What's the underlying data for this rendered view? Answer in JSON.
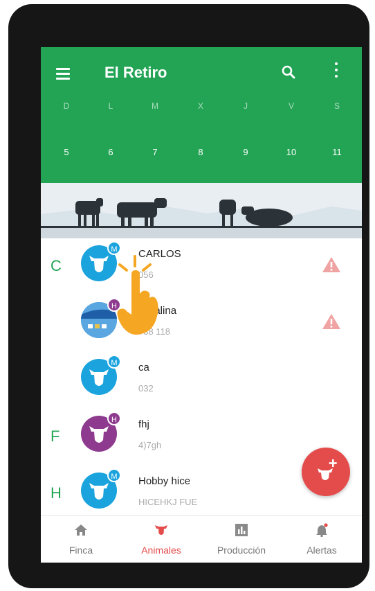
{
  "header": {
    "title": "El Retiro",
    "days": [
      "D",
      "L",
      "M",
      "X",
      "J",
      "V",
      "S"
    ],
    "dates": [
      "5",
      "6",
      "7",
      "8",
      "9",
      "10",
      "11"
    ]
  },
  "animals": [
    {
      "letter": "C",
      "badge": "M",
      "name": "CARLOS",
      "code": "056",
      "alert": true,
      "avatar": "cow-blue"
    },
    {
      "letter": "",
      "badge": "H",
      "name": "Catalina",
      "code": "738 118",
      "alert": true,
      "avatar": "photo"
    },
    {
      "letter": "",
      "badge": "M",
      "name": "ca",
      "code": "032",
      "alert": false,
      "avatar": "cow-blue"
    },
    {
      "letter": "F",
      "badge": "H",
      "name": "fhj",
      "code": "4)7gh",
      "alert": false,
      "avatar": "cow-purple"
    },
    {
      "letter": "H",
      "badge": "M",
      "name": "Hobby hice",
      "code": "HICEHKJ FUE",
      "alert": false,
      "avatar": "cow-blue"
    }
  ],
  "nav": [
    {
      "label": "Finca",
      "icon": "home-icon"
    },
    {
      "label": "Animales",
      "icon": "cow-icon",
      "active": true
    },
    {
      "label": "Producción",
      "icon": "chart-icon"
    },
    {
      "label": "Alertas",
      "icon": "bell-icon"
    }
  ],
  "colors": {
    "primary": "#23a455",
    "accent": "#e44c4c",
    "male": "#1ba3dd",
    "female": "#8e3a8f"
  }
}
